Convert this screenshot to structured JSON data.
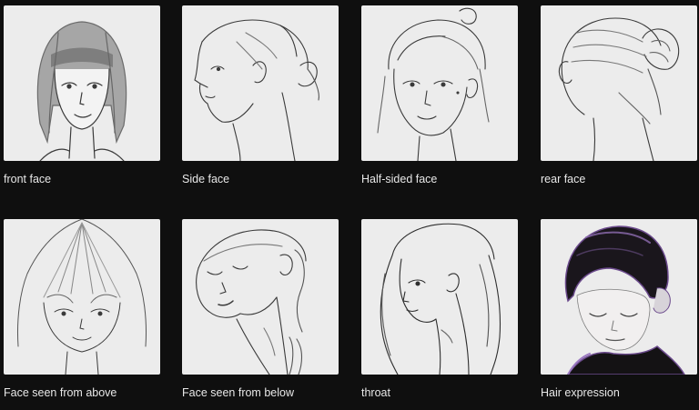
{
  "gallery": {
    "items": [
      {
        "label": "front face",
        "illustration": "front-face-sketch"
      },
      {
        "label": "Side face",
        "illustration": "side-face-sketch"
      },
      {
        "label": "Half-sided face",
        "illustration": "half-sided-face-sketch"
      },
      {
        "label": "rear face",
        "illustration": "rear-face-sketch"
      },
      {
        "label": "Face seen from above",
        "illustration": "face-from-above-sketch"
      },
      {
        "label": "Face seen from below",
        "illustration": "face-from-below-sketch"
      },
      {
        "label": "throat",
        "illustration": "throat-sketch"
      },
      {
        "label": "Hair expression",
        "illustration": "hair-expression-painting"
      }
    ]
  },
  "colors": {
    "background": "#0f0f0f",
    "card": "#ececec",
    "caption": "#e8e8e8",
    "ink": "#3a3a3a"
  }
}
